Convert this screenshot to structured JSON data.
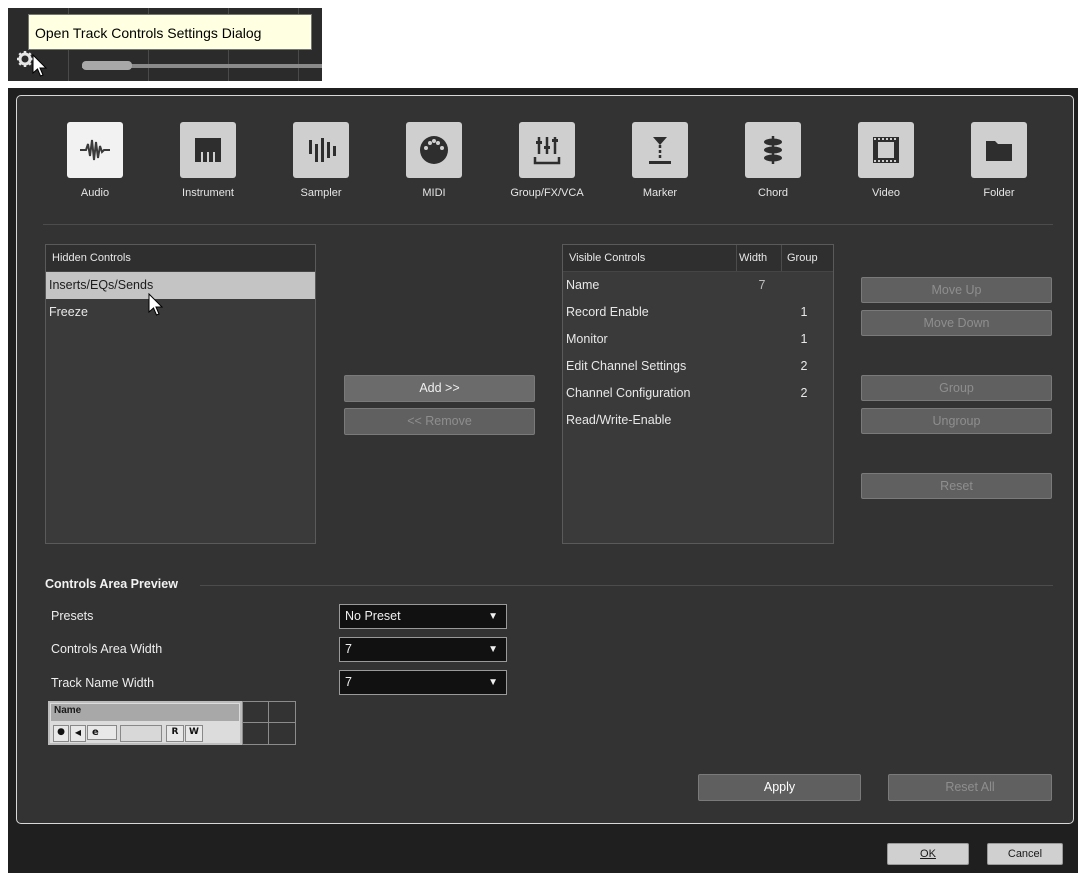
{
  "tooltip": {
    "text": "Open Track Controls Settings Dialog"
  },
  "track_types": [
    {
      "label": "Audio",
      "icon": "audio-waveform-icon",
      "selected": true
    },
    {
      "label": "Instrument",
      "icon": "piano-keys-icon",
      "selected": false
    },
    {
      "label": "Sampler",
      "icon": "sampler-icon",
      "selected": false
    },
    {
      "label": "MIDI",
      "icon": "midi-connector-icon",
      "selected": false
    },
    {
      "label": "Group/FX/VCA",
      "icon": "mixer-faders-icon",
      "selected": false
    },
    {
      "label": "Marker",
      "icon": "marker-icon",
      "selected": false
    },
    {
      "label": "Chord",
      "icon": "chord-icon",
      "selected": false
    },
    {
      "label": "Video",
      "icon": "film-strip-icon",
      "selected": false
    },
    {
      "label": "Folder",
      "icon": "folder-icon",
      "selected": false
    }
  ],
  "hidden_controls": {
    "header": "Hidden Controls",
    "items": [
      "Inserts/EQs/Sends",
      "Freeze"
    ],
    "selected_index": 0
  },
  "transfer": {
    "add": "Add >>",
    "remove": "<< Remove"
  },
  "visible_controls": {
    "headers": {
      "name": "Visible Controls",
      "width": "Width",
      "group": "Group"
    },
    "rows": [
      {
        "name": "Name",
        "width": "7",
        "group": ""
      },
      {
        "name": "Record Enable",
        "width": "",
        "group": "1"
      },
      {
        "name": "Monitor",
        "width": "",
        "group": "1"
      },
      {
        "name": "Edit Channel Settings",
        "width": "",
        "group": "2"
      },
      {
        "name": "Channel Configuration",
        "width": "",
        "group": "2"
      },
      {
        "name": "Read/Write-Enable",
        "width": "",
        "group": ""
      }
    ]
  },
  "side_buttons": {
    "move_up": "Move Up",
    "move_down": "Move Down",
    "group": "Group",
    "ungroup": "Ungroup",
    "reset": "Reset"
  },
  "preview": {
    "section": "Controls Area Preview",
    "presets_label": "Presets",
    "presets_value": "No Preset",
    "width_label": "Controls Area Width",
    "width_value": "7",
    "name_width_label": "Track Name Width",
    "name_width_value": "7",
    "track_name": "Name"
  },
  "actions": {
    "apply": "Apply",
    "reset_all": "Reset All"
  },
  "footer": {
    "ok": "OK",
    "cancel": "Cancel"
  }
}
